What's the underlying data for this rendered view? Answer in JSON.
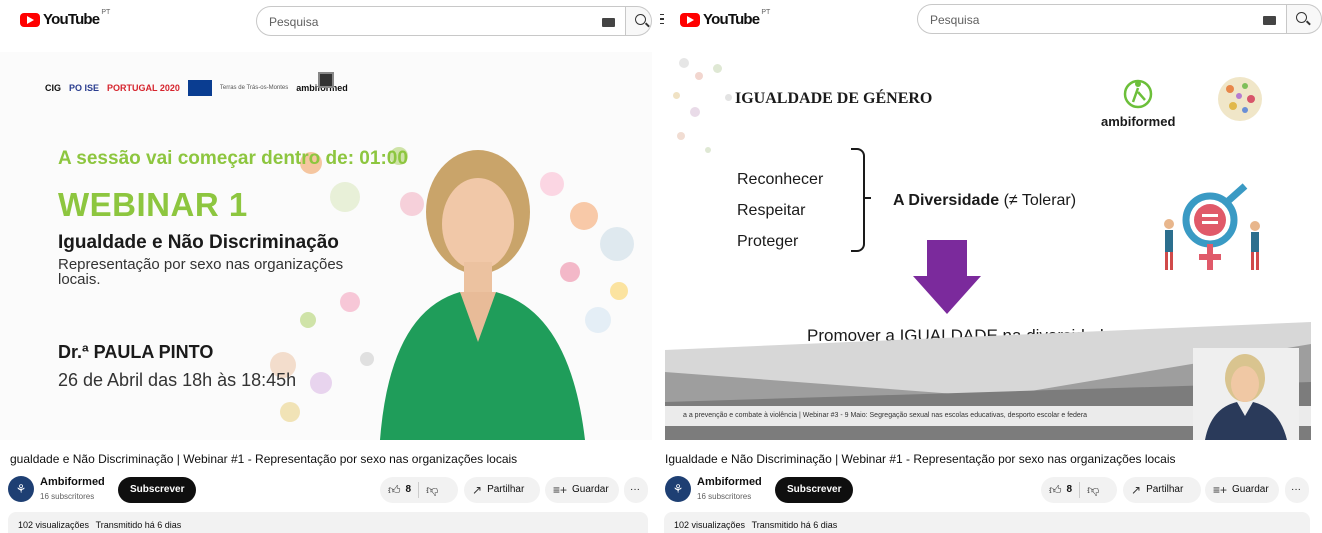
{
  "app": {
    "name": "YouTube",
    "country_code": "PT"
  },
  "search": {
    "placeholder": "Pesquisa"
  },
  "left": {
    "sponsors": [
      "CIG",
      "PO ISE",
      "PORTUGAL 2020",
      "Terras de Trás-os-Montes",
      "ambiformed"
    ],
    "slide": {
      "countdown": "A sessão vai começar dentro de:  01:00",
      "title": "WEBINAR 1",
      "subtitle": "Igualdade e Não Discriminação",
      "description": "Representação por sexo nas organizações locais.",
      "speaker": "Dr.ª PAULA PINTO",
      "date": "26 de Abril das 18h às 18:45h"
    },
    "video_title": "gualdade e Não Discriminação | Webinar #1 - Representação por sexo nas organizações locais"
  },
  "right": {
    "slide": {
      "title": "IGUALDADE DE GÉNERO",
      "brand": "ambiformed",
      "verbs": [
        "Reconhecer",
        "Respeitar",
        "Proteger"
      ],
      "diversity_bold": "A Diversidade",
      "diversity_rest": " (≠ Tolerar)",
      "promote": "Promover a IGUALDADE na diversidade",
      "ticker": "a a prevenção e combate à violência | Webinar #3 - 9 Maio: Segregação sexual nas escolas educativas, desporto escolar e federa"
    },
    "video_title": "Igualdade e Não Discriminação | Webinar #1 - Representação por sexo nas organizações locais"
  },
  "channel": {
    "name": "Ambiformed",
    "subscribers": "16 subscritores",
    "subscribe_label": "Subscrever"
  },
  "actions": {
    "likes": "8",
    "share_label": "Partilhar",
    "save_label": "Guardar",
    "more": "···"
  },
  "description": {
    "views": "102 visualizações",
    "streamed": "Transmitido há 6 dias"
  },
  "colors": {
    "brand_red": "#ff0000",
    "accent_green": "#8dc63f",
    "arrow_purple": "#7b2a9c"
  }
}
